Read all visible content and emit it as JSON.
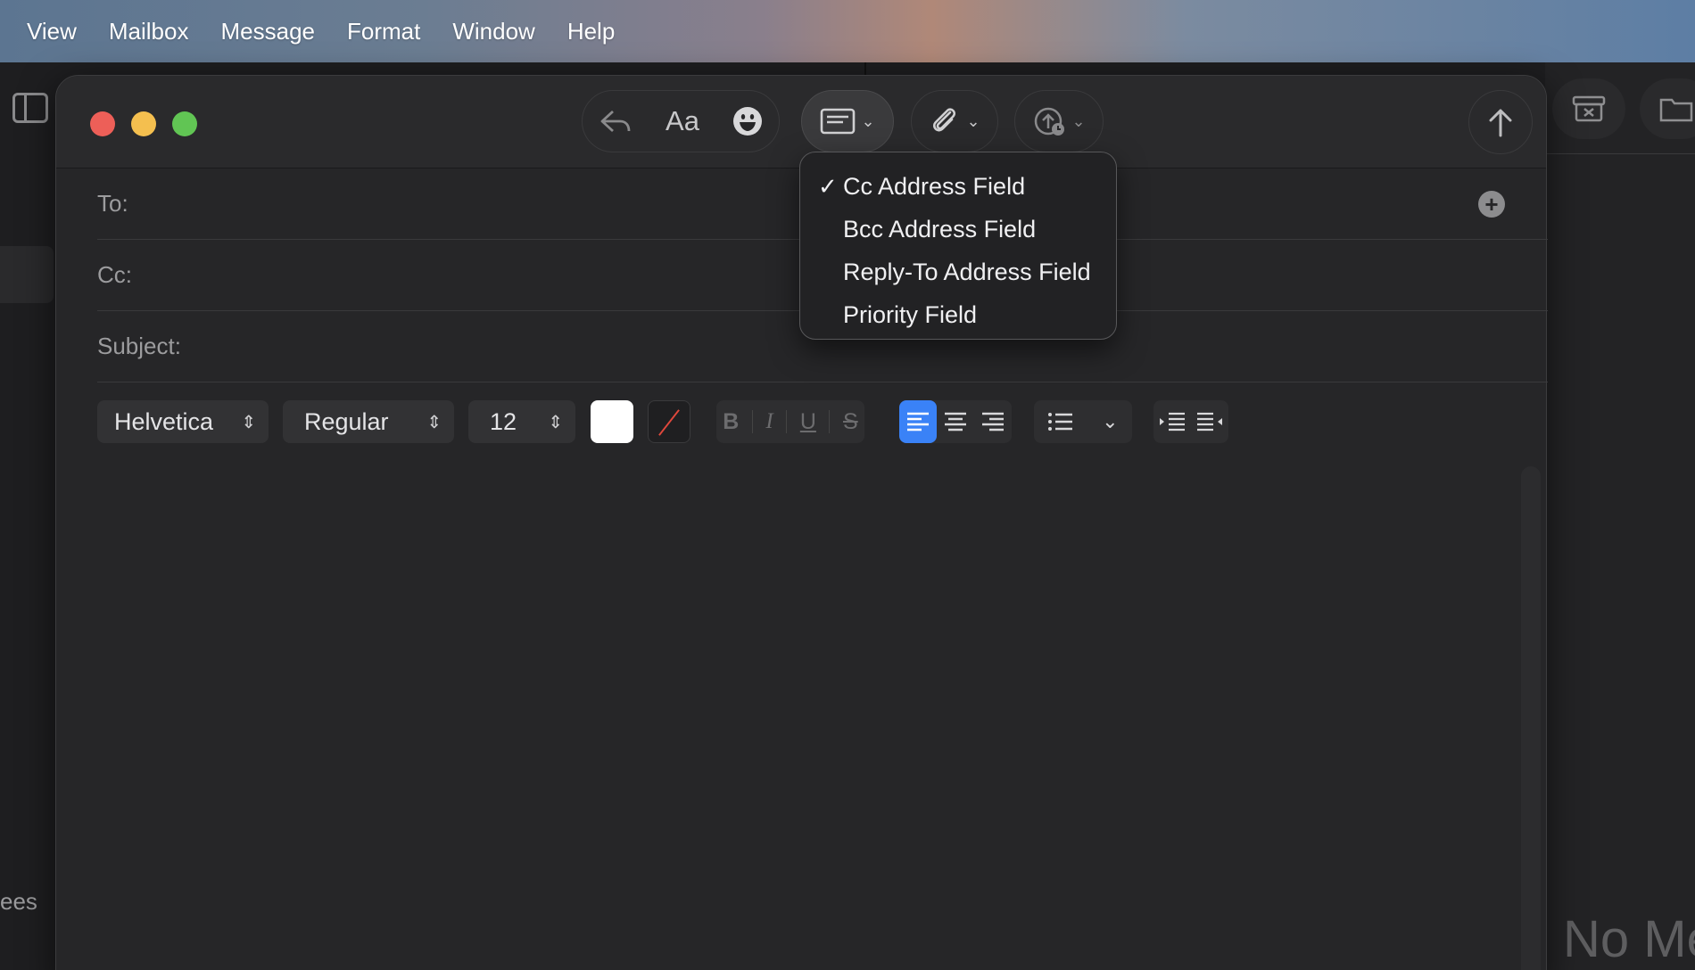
{
  "menubar": {
    "items": [
      "View",
      "Mailbox",
      "Message",
      "Format",
      "Window",
      "Help"
    ]
  },
  "background": {
    "sidebar_snippet": "ees",
    "empty_state_text": "No Me"
  },
  "compose": {
    "fields": {
      "to_label": "To:",
      "cc_label": "Cc:",
      "subject_label": "Subject:"
    },
    "toolbar": {
      "font_style_label": "Aa",
      "header_fields_menu_open": true
    },
    "format_bar": {
      "font_family": "Helvetica",
      "font_weight": "Regular",
      "font_size": "12",
      "bold": "B",
      "italic": "I",
      "underline": "U",
      "strikethrough": "S",
      "text_color": "#ffffff",
      "active_alignment": "left"
    }
  },
  "header_fields_menu": {
    "items": [
      {
        "label": "Cc Address Field",
        "checked": true
      },
      {
        "label": "Bcc Address Field",
        "checked": false
      },
      {
        "label": "Reply-To Address Field",
        "checked": false
      },
      {
        "label": "Priority Field",
        "checked": false
      }
    ],
    "check_glyph": "✓"
  },
  "colors": {
    "close": "#ed5f58",
    "minimize": "#f4bf4f",
    "zoom": "#61c554",
    "accent": "#3a82f7"
  }
}
